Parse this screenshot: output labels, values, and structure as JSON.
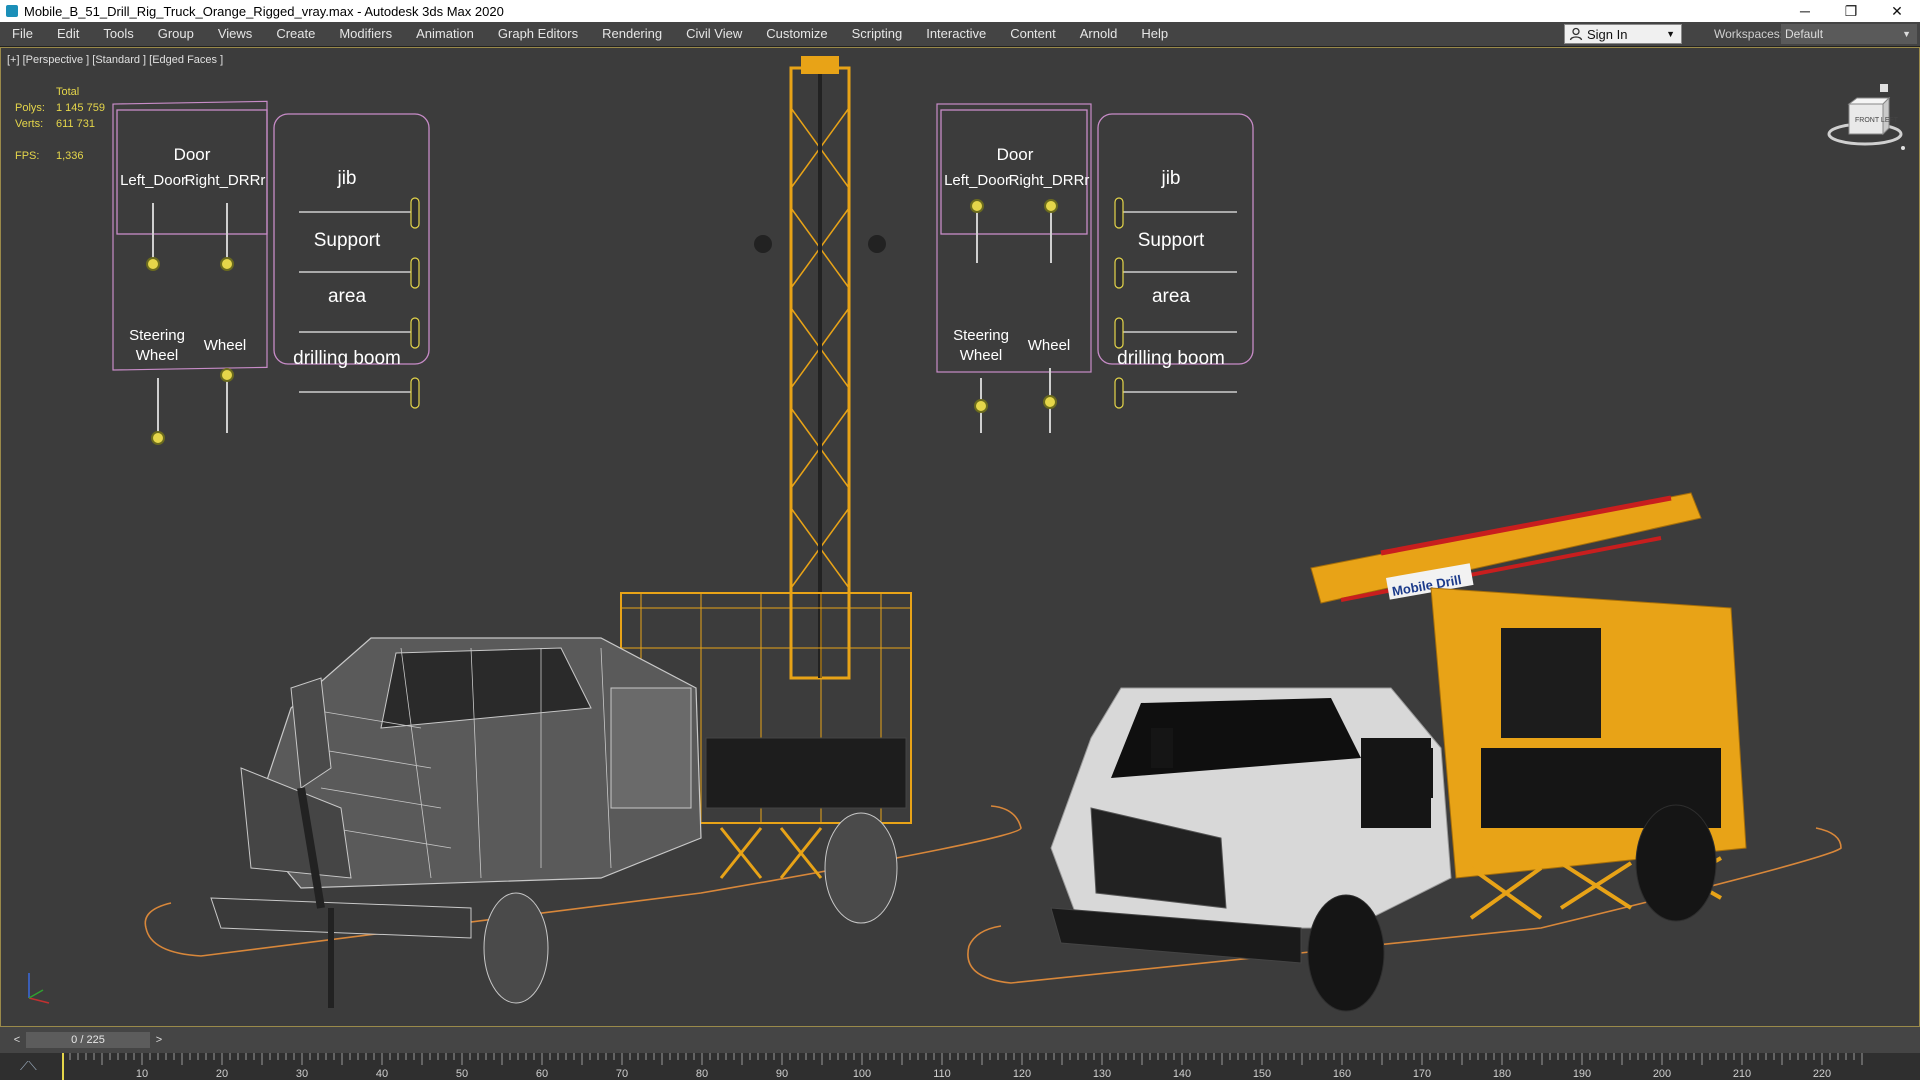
{
  "window": {
    "title": "Mobile_B_51_Drill_Rig_Truck_Orange_Rigged_vray.max - Autodesk 3ds Max 2020",
    "minimize": "─",
    "restore": "❐",
    "close": "✕"
  },
  "menus": [
    "File",
    "Edit",
    "Tools",
    "Group",
    "Views",
    "Create",
    "Modifiers",
    "Animation",
    "Graph Editors",
    "Rendering",
    "Civil View",
    "Customize",
    "Scripting",
    "Interactive",
    "Content",
    "Arnold",
    "Help"
  ],
  "signin": {
    "label": "Sign In"
  },
  "workspaces": {
    "label": "Workspaces:",
    "value": "Default"
  },
  "viewport": {
    "label": "[+] [Perspective ] [Standard ] [Edged Faces ]",
    "stats": {
      "header": "Total",
      "polys_label": "Polys:",
      "polys": "1 145 759",
      "verts_label": "Verts:",
      "verts": "611 731",
      "fps_label": "FPS:",
      "fps": "1,336"
    },
    "viewcube_label": "FRONT  LEFT"
  },
  "rig_panels": {
    "door_title": "Door",
    "left_door": "Left_Door",
    "right_door": "Right_DRRr",
    "steering_line1": "Steering",
    "steering_line2": "Wheel",
    "wheel": "Wheel",
    "jib": "jib",
    "support": "Support",
    "area": "area",
    "drilling_boom": "drilling boom"
  },
  "truck_label": "Mobile Drill",
  "timeline": {
    "prev": "<",
    "position": "0 / 225",
    "next": ">",
    "ticks": [
      "10",
      "20",
      "30",
      "40",
      "50",
      "60",
      "70",
      "80",
      "90",
      "100",
      "110",
      "120",
      "130",
      "140",
      "150",
      "160",
      "170",
      "180",
      "190",
      "200",
      "210",
      "220"
    ]
  },
  "colors": {
    "accent_yellow": "#e5d64a",
    "rig_orange": "#e8a317",
    "panel_pink": "#c88cc8",
    "wire": "#c8c8c8"
  }
}
